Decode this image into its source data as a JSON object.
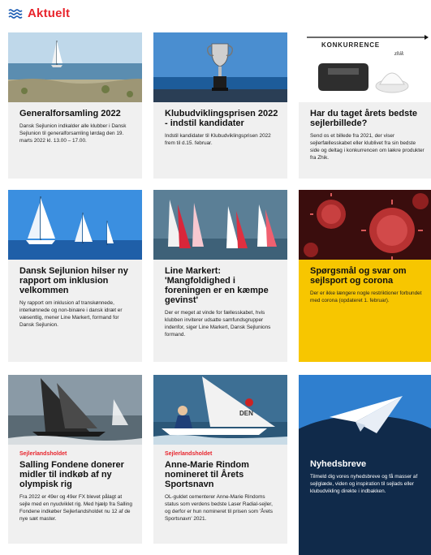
{
  "header": {
    "title": "Aktuelt",
    "icon": "waves-icon"
  },
  "cards": [
    {
      "title": "Generalforsamling 2022",
      "text": "Dansk Sejlunion indkalder alle klubber i Dansk Sejlunion til generalforsamling lørdag den 19. marts 2022 kl. 13.00 – 17.00."
    },
    {
      "title": "Klubudviklingsprisen 2022 - indstil kandidater",
      "text": "Indstil kandidater til Klubudviklingsprisen 2022 frem til d.15. februar."
    },
    {
      "banner": "KONKURRENCE",
      "banner_script": "zhik",
      "title": "Har du taget årets bedste sejlerbillede?",
      "text": "Send os et billede fra 2021, der viser sejlerfællesskabet eller klublivet fra sin bedste side og deltag i konkurrencen om lækre produkter fra Zhik."
    },
    {
      "title": "Dansk Sejlunion hilser ny rapport om inklusion velkommen",
      "text": "Ny rapport om inklusion af transkønnede, interkønnede og non-binære i dansk idræt er væsentlig, mener Line Markert, formand for Dansk Sejlunion."
    },
    {
      "title": "Line Markert: 'Mangfoldighed i foreningen er en kæmpe gevinst'",
      "text": "Der er meget at vinde for fællesskabet, hvis klubben inviterer udsatte samfundsgrupper indenfor, siger Line Markert, Dansk Sejlunions formand."
    },
    {
      "title": "Spørgsmål og svar om sejlsport og corona",
      "text": "Der er ikke længere nogle restriktioner forbundet med corona (opdateret 1. februar)."
    },
    {
      "category": "Sejlerlandsholdet",
      "title": "Salling Fondene donerer midler til indkøb af ny olympisk rig",
      "text": "Fra 2022 er 49er og 49er FX blevet pålagt at sejle med en nyudviklet rig. Med hjælp fra Salling Fondene indkøber Sejlerlandsholdet nu 12 af de nye sæt master."
    },
    {
      "category": "Sejlerlandsholdet",
      "title": "Anne-Marie Rindom nomineret til Årets Sportsnavn",
      "text": "OL-guldet cementerer Anne-Marie Rindoms status som verdens bedste Laser Radial-sejler, og derfor er hun nomineret til prisen som 'Årets Sportsnavn' 2021."
    },
    {
      "title": "Nyhedsbreve",
      "text": "Tilmeld dig vores nyhedsbreve og få masser af sejlglæde, viden og inspiration til sejlads eller klubudvikling direkte i indbakken."
    }
  ]
}
